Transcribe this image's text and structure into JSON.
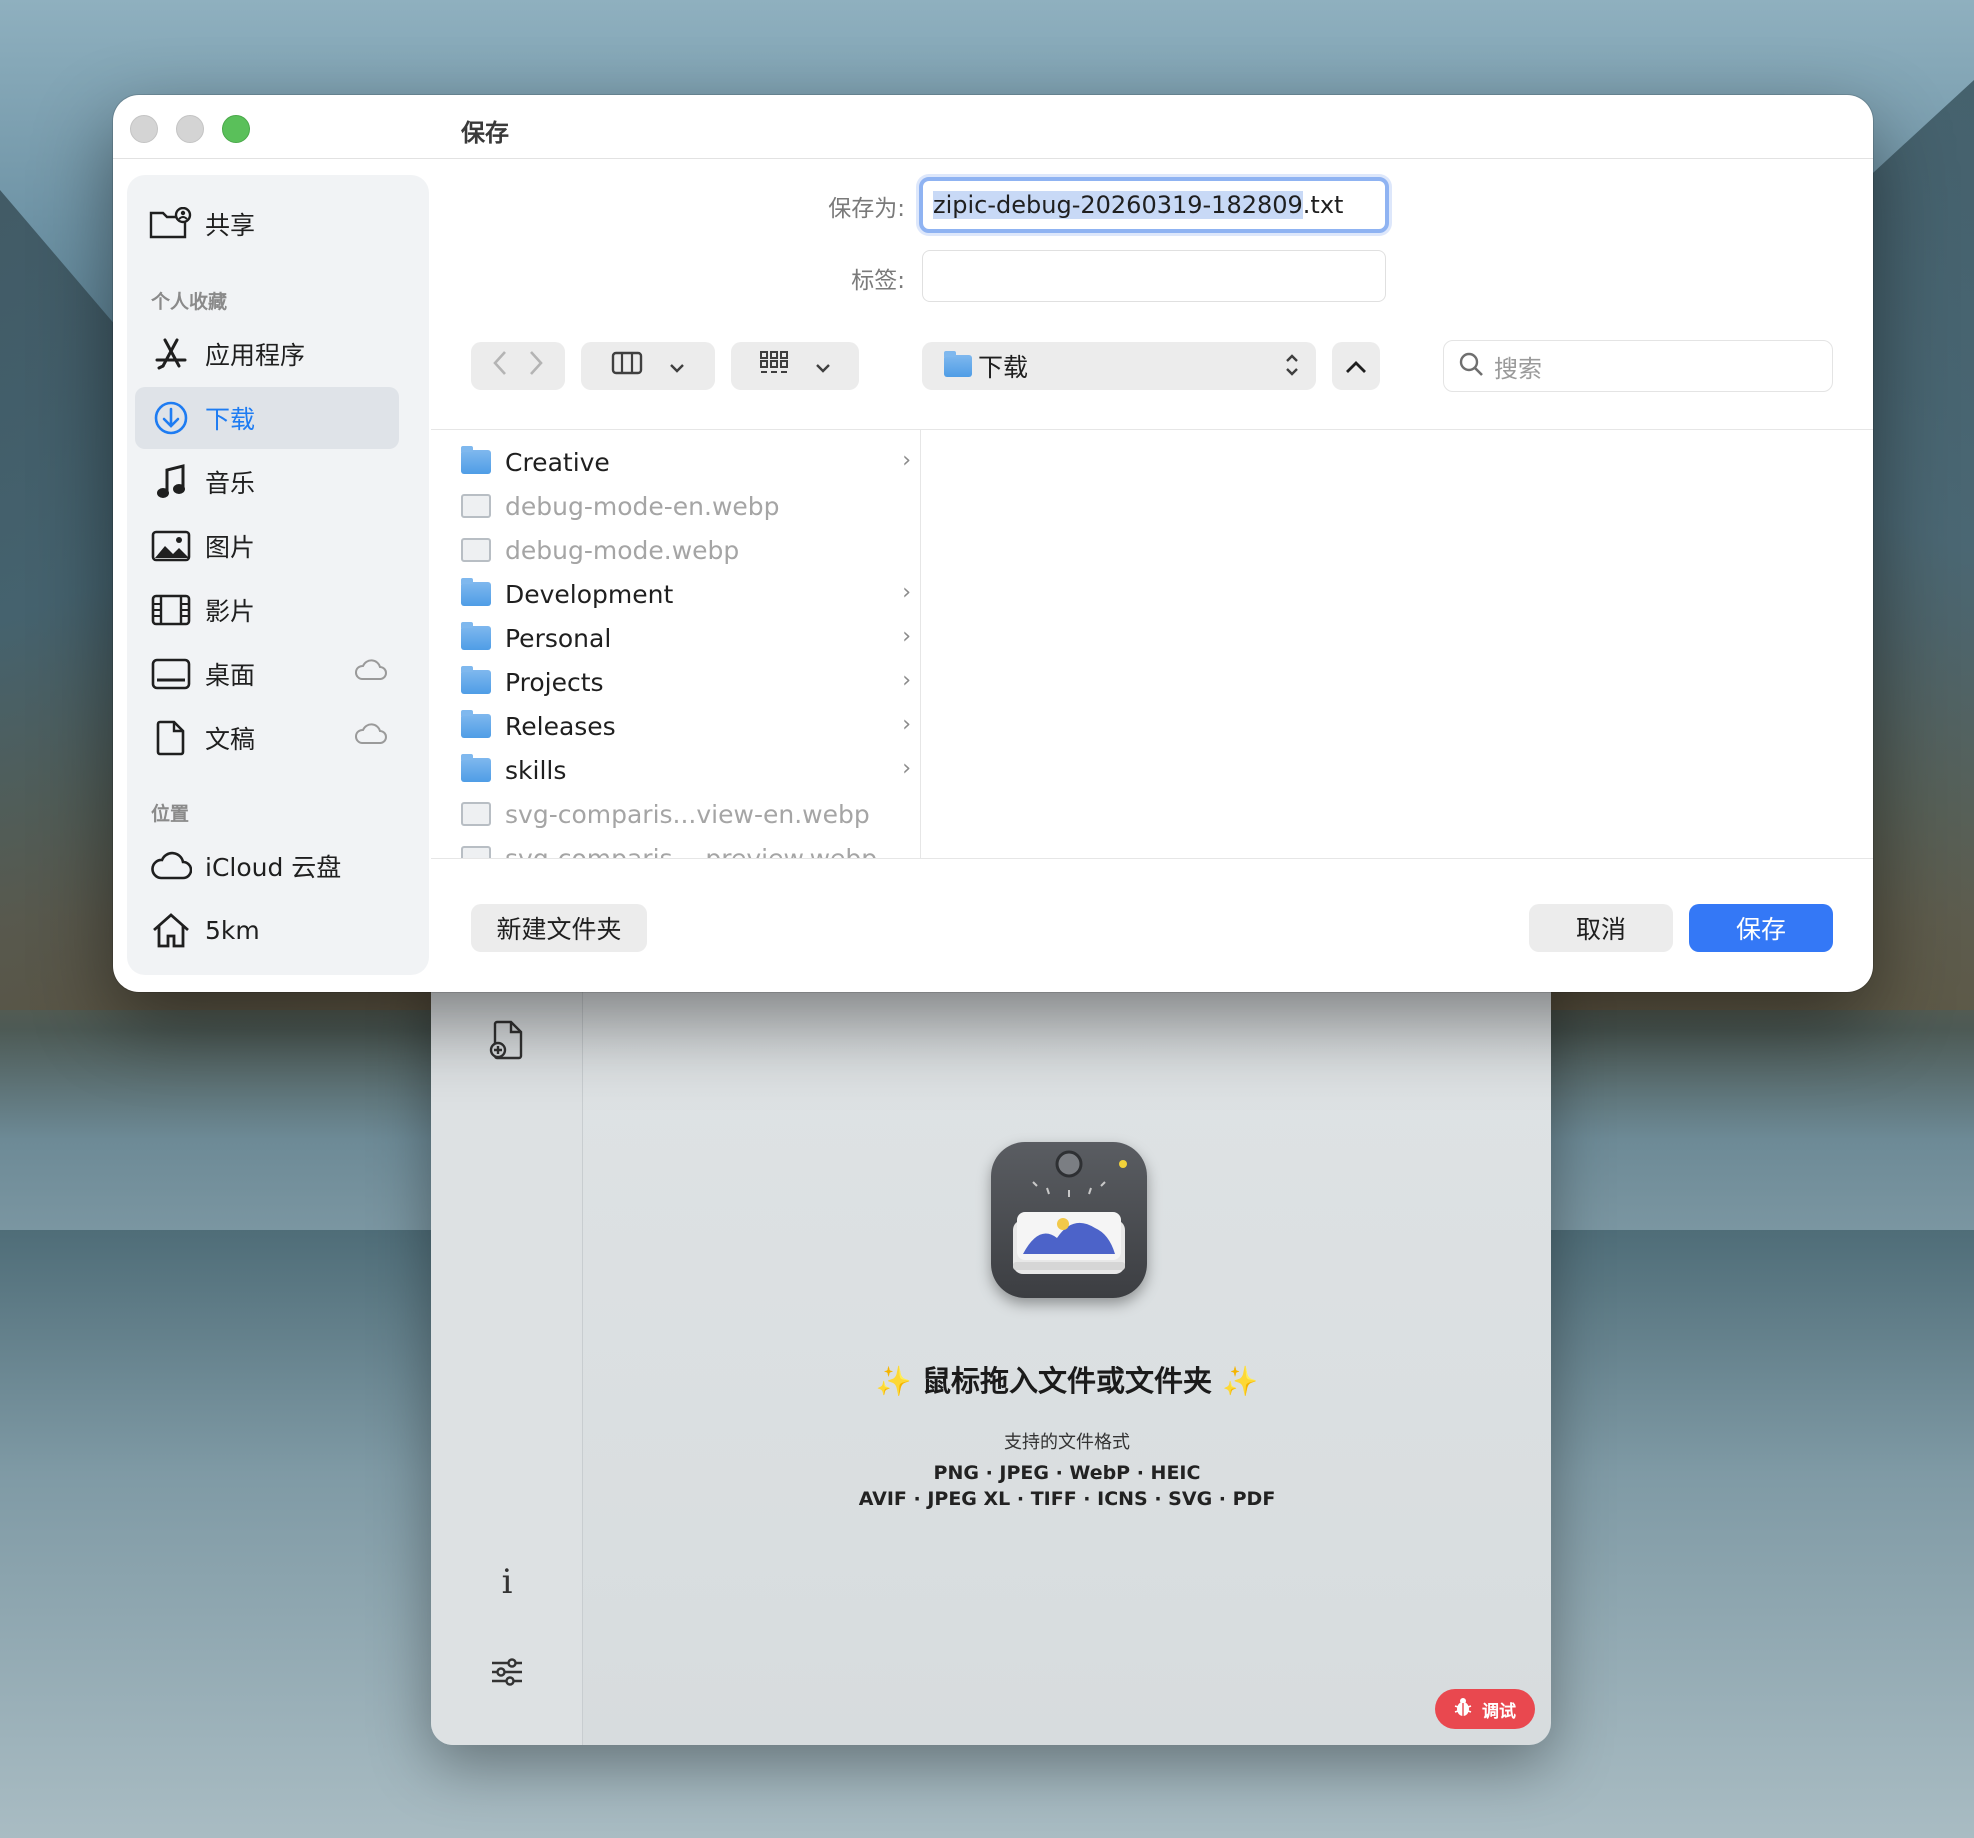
{
  "dialog": {
    "title": "保存",
    "save_as_label": "保存为:",
    "filename_selected": "zipic-debug-20260319-182809",
    "filename_ext": ".txt",
    "tags_label": "标签:",
    "location": "下载",
    "search_placeholder": "搜索",
    "new_folder": "新建文件夹",
    "cancel": "取消",
    "save": "保存"
  },
  "sidebar": {
    "shared": "共享",
    "favorites_heading": "个人收藏",
    "locations_heading": "位置",
    "items": [
      {
        "label": "应用程序",
        "icon": "app-store-icon"
      },
      {
        "label": "下载",
        "icon": "download-icon",
        "active": true
      },
      {
        "label": "音乐",
        "icon": "music-icon"
      },
      {
        "label": "图片",
        "icon": "photo-icon"
      },
      {
        "label": "影片",
        "icon": "film-icon"
      },
      {
        "label": "桌面",
        "icon": "desktop-icon",
        "icloud": true
      },
      {
        "label": "文稿",
        "icon": "document-icon",
        "icloud": true
      }
    ],
    "locations": [
      {
        "label": "iCloud 云盘",
        "icon": "cloud-icon"
      },
      {
        "label": "5km",
        "icon": "home-icon"
      }
    ]
  },
  "files": [
    {
      "name": "Creative",
      "type": "folder"
    },
    {
      "name": "debug-mode-en.webp",
      "type": "image"
    },
    {
      "name": "debug-mode.webp",
      "type": "image"
    },
    {
      "name": "Development",
      "type": "folder"
    },
    {
      "name": "Personal",
      "type": "folder"
    },
    {
      "name": "Projects",
      "type": "folder"
    },
    {
      "name": "Releases",
      "type": "folder"
    },
    {
      "name": "skills",
      "type": "folder"
    },
    {
      "name": "svg-comparis...view-en.webp",
      "type": "image"
    },
    {
      "name": "svg-comparis...-preview.webp",
      "type": "image"
    }
  ],
  "app": {
    "drop_title": "✨ 鼠标拖入文件或文件夹 ✨",
    "supported_label": "支持的文件格式",
    "formats_line1": "PNG · JPEG · WebP · HEIC",
    "formats_line2": "AVIF · JPEG XL · TIFF · ICNS · SVG · PDF",
    "debug_badge": "调试"
  },
  "colors": {
    "accent": "#3478f6",
    "sidebar_active_text": "#1e7cf2",
    "debug_badge": "#e9484f"
  }
}
